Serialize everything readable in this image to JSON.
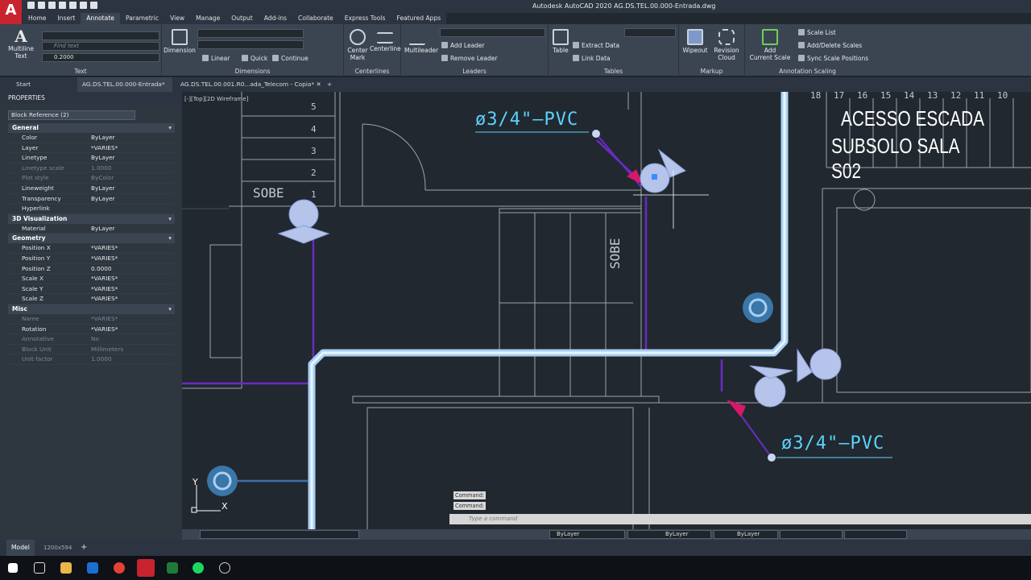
{
  "app": {
    "logo_letter": "A",
    "title": "Autodesk AutoCAD 2020   AG.DS.TEL.00.000-Entrada.dwg"
  },
  "ribbon_tabs": [
    "Home",
    "Insert",
    "Annotate",
    "Parametric",
    "View",
    "Manage",
    "Output",
    "Add-ins",
    "Collaborate",
    "Express Tools",
    "Featured Apps"
  ],
  "ribbon": {
    "text": {
      "multiline": "Multiline",
      "multiline2": "Text",
      "find_placeholder": "Find text",
      "height": "0.2000",
      "label": "Text"
    },
    "dimensions": {
      "dimension": "Dimension",
      "linear": "Linear",
      "quick": "Quick",
      "continue": "Continue",
      "label": "Dimensions"
    },
    "centerlines": {
      "center_mark": "Center",
      "center_mark2": "Mark",
      "centerline": "Centerline",
      "label": "Centerlines"
    },
    "leaders": {
      "multileader": "Multileader",
      "add": "Add Leader",
      "remove": "Remove Leader",
      "label": "Leaders"
    },
    "tables": {
      "table": "Table",
      "extract": "Extract Data",
      "link": "Link Data",
      "label": "Tables"
    },
    "markup": {
      "wipeout": "Wipeout",
      "cloud": "Revision",
      "cloud2": "Cloud",
      "label": "Markup"
    },
    "scaling": {
      "add": "Add",
      "add2": "Current Scale",
      "list": "Scale List",
      "adddel": "Add/Delete Scales",
      "sync": "Sync Scale Positions",
      "label": "Annotation Scaling"
    }
  },
  "doc_tabs": {
    "start": "Start",
    "active": "AG.DS.TEL.00.000-Entrada*",
    "other": "AG.DS.TEL.00.001.R0...ada_Telecom - Copia*"
  },
  "properties": {
    "header": "PROPERTIES",
    "selection": "Block Reference (2)",
    "sections": {
      "general": "General",
      "visual": "3D Visualization",
      "geometry": "Geometry",
      "misc": "Misc"
    },
    "general": [
      {
        "k": "Color",
        "v": "ByLayer"
      },
      {
        "k": "Layer",
        "v": "*VARIES*"
      },
      {
        "k": "Linetype",
        "v": "ByLayer"
      },
      {
        "k": "Linetype scale",
        "v": "1.0000"
      },
      {
        "k": "Plot style",
        "v": "ByColor"
      },
      {
        "k": "Lineweight",
        "v": "ByLayer"
      },
      {
        "k": "Transparency",
        "v": "ByLayer"
      },
      {
        "k": "Hyperlink",
        "v": ""
      }
    ],
    "visual": [
      {
        "k": "Material",
        "v": "ByLayer"
      }
    ],
    "geometry": [
      {
        "k": "Position X",
        "v": "*VARIES*"
      },
      {
        "k": "Position Y",
        "v": "*VARIES*"
      },
      {
        "k": "Position Z",
        "v": "0.0000"
      },
      {
        "k": "Scale X",
        "v": "*VARIES*"
      },
      {
        "k": "Scale Y",
        "v": "*VARIES*"
      },
      {
        "k": "Scale Z",
        "v": "*VARIES*"
      }
    ],
    "misc": [
      {
        "k": "Name",
        "v": "*VARIES*"
      },
      {
        "k": "Rotation",
        "v": "*VARIES*"
      },
      {
        "k": "Annotative",
        "v": "No"
      },
      {
        "k": "Block Unit",
        "v": "Millimeters"
      },
      {
        "k": "Unit factor",
        "v": "1.0000"
      }
    ]
  },
  "viewport": {
    "label": "[-][Top][2D Wireframe]"
  },
  "drawing": {
    "pvc_top": "ø3/4\"—PVC",
    "pvc_bottom": "ø3/4\"—PVC",
    "sobe_left": "SOBE",
    "sobe_right": "SOBE",
    "title1": "ACESSO ESCADA",
    "title2": "SUBSOLO SALA S02",
    "step_numbers": [
      "5",
      "4",
      "3",
      "2",
      "1"
    ],
    "top_numbers": [
      "18",
      "17",
      "16",
      "15",
      "14",
      "13",
      "12",
      "11",
      "10"
    ],
    "axis_x": "X",
    "axis_y": "Y"
  },
  "command": {
    "line1": "Command:",
    "line2": "Command:",
    "placeholder": "Type a command"
  },
  "statusbar": {
    "layer": "ByLayer",
    "linetype": "ByLayer",
    "lineweight": "ByLayer"
  },
  "modelbar": {
    "model": "Model",
    "size": "1200x594"
  }
}
